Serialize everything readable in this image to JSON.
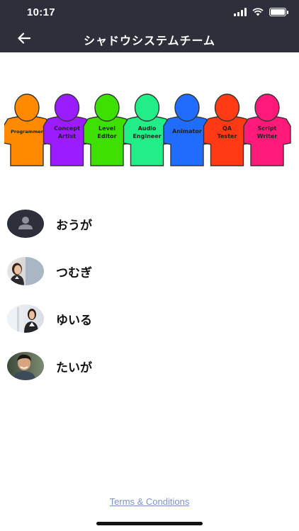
{
  "status": {
    "time": "10:17"
  },
  "nav": {
    "title": "シャドウシステムチーム",
    "back_icon": "arrow-left-icon"
  },
  "banner": {
    "roles": [
      {
        "line1": "Programmer",
        "line2": "",
        "color": "#ff8a00"
      },
      {
        "line1": "Concept",
        "line2": "Artist",
        "color": "#9b1cff"
      },
      {
        "line1": "Level",
        "line2": "Editor",
        "color": "#3de000"
      },
      {
        "line1": "Audio",
        "line2": "Engineer",
        "color": "#22ee88"
      },
      {
        "line1": "Animator",
        "line2": "",
        "color": "#1f6cff"
      },
      {
        "line1": "QA",
        "line2": "Tester",
        "color": "#ff3a14"
      },
      {
        "line1": "Script",
        "line2": "Writer",
        "color": "#ff1a7a"
      }
    ]
  },
  "members": [
    {
      "name": "おうが",
      "avatar": "placeholder-person-icon"
    },
    {
      "name": "つむぎ",
      "avatar": "photo"
    },
    {
      "name": "ゆいる",
      "avatar": "photo"
    },
    {
      "name": "たいが",
      "avatar": "photo"
    }
  ],
  "footer": {
    "terms_label": "Terms & Conditions"
  }
}
